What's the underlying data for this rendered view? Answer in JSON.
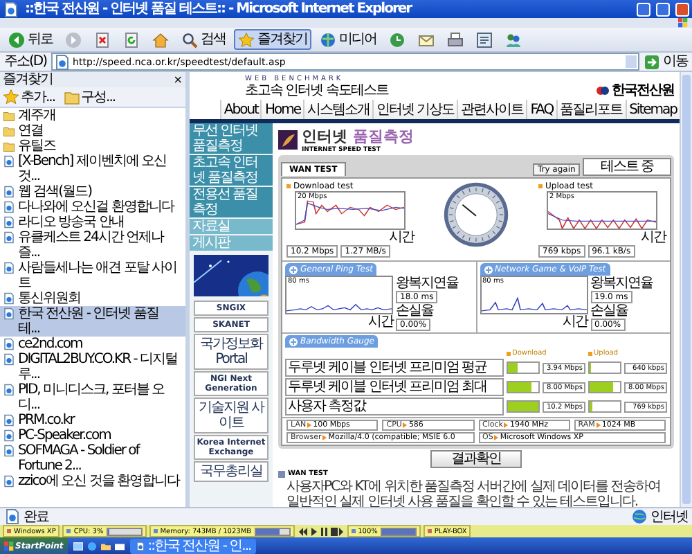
{
  "window": {
    "title": "::한국 전산원 - 인터넷 품질 테스트:: - Microsoft Internet Explorer"
  },
  "toolbar": [
    {
      "kind": "back",
      "label": "뒤로",
      "pressed": false
    },
    {
      "kind": "forward",
      "pressed": false
    },
    {
      "kind": "stop",
      "pressed": false
    },
    {
      "kind": "refresh",
      "pressed": false
    },
    {
      "kind": "home",
      "pressed": false
    },
    {
      "kind": "search",
      "label": "검색",
      "pressed": false
    },
    {
      "kind": "favorites",
      "label": "즐겨찾기",
      "pressed": true
    },
    {
      "kind": "media",
      "label": "미디어",
      "pressed": false
    },
    {
      "kind": "history",
      "pressed": false
    },
    {
      "kind": "mail",
      "pressed": false
    },
    {
      "kind": "print",
      "pressed": false
    },
    {
      "kind": "edit",
      "pressed": false
    },
    {
      "kind": "messenger",
      "pressed": false
    }
  ],
  "address_bar": {
    "label": "주소(D)",
    "url": "http://speed.nca.or.kr/speedtest/default.asp",
    "go": "이동"
  },
  "favorites": {
    "title": "즐겨찾기",
    "close": "×",
    "add": "추가...",
    "organize": "구성...",
    "items": [
      {
        "kind": "folder",
        "label": "계주개",
        "selected": false
      },
      {
        "kind": "folder",
        "label": "연결",
        "selected": false
      },
      {
        "kind": "folder",
        "label": "유틸즈",
        "selected": false
      },
      {
        "kind": "link",
        "label": "[X-Bench] 제이벤치에 오신 것...",
        "selected": false
      },
      {
        "kind": "link",
        "label": "웹 검색(월드)",
        "selected": false
      },
      {
        "kind": "link",
        "label": "다나와에 오신걸 환영합니다",
        "selected": false
      },
      {
        "kind": "link",
        "label": "라디오 방송국 안내",
        "selected": false
      },
      {
        "kind": "link",
        "label": "유클케스트 24시간 언제나 즐...",
        "selected": false
      },
      {
        "kind": "link",
        "label": "사람들세나는 애견 포탈 사이트",
        "selected": false
      },
      {
        "kind": "link",
        "label": "통신위원회",
        "selected": false
      },
      {
        "kind": "link",
        "label": "한국 전산원 - 인터넷 품질 테...",
        "selected": true
      },
      {
        "kind": "link",
        "label": "ce2nd.com",
        "selected": false
      },
      {
        "kind": "link",
        "label": "DIGITAL2BUY.CO.KR - 디지털루...",
        "selected": false
      },
      {
        "kind": "link",
        "label": "PID, 미니디스크, 포터블 오디...",
        "selected": false
      },
      {
        "kind": "link",
        "label": "PRM.co.kr",
        "selected": false
      },
      {
        "kind": "link",
        "label": "PC-Speaker.com",
        "selected": false
      },
      {
        "kind": "link",
        "label": "SOFMAGA - Soldier of Fortune 2...",
        "selected": false
      },
      {
        "kind": "link",
        "label": "zzico에 오신 것을 환영합니다",
        "selected": false
      }
    ]
  },
  "page": {
    "brand": "WEB BENCHMARK",
    "subtitle": "초고속 인터넷 속도테스트",
    "org": "한국전산원",
    "menu": [
      "About",
      "Home",
      "시스템소개",
      "인터넷 기상도",
      "관련사이트",
      "FAQ",
      "품질리포트",
      "Sitemap"
    ],
    "nav": [
      "무선 인터넷 품질측정",
      "초고속 인터넷 품질측정",
      "전용선 품질측정",
      "자료실",
      "게시판"
    ],
    "banners": [
      {
        "kind": "picture"
      },
      {
        "kind": "logo",
        "text": "SNGIX"
      },
      {
        "kind": "logo",
        "text": "SKANET"
      },
      {
        "kind": "logo",
        "text": "국가정보화 Portal"
      },
      {
        "kind": "logo",
        "text": "NGI Next Generation"
      },
      {
        "kind": "logo",
        "text": "기술지원 사이트"
      },
      {
        "kind": "logo",
        "text": "Korea Internet Exchange"
      },
      {
        "kind": "logo",
        "text": "국무총리실"
      }
    ],
    "test": {
      "heading": "인터넷",
      "heading_accent": "품질측정",
      "heading_sub": "INTERNET SPEED TEST",
      "tab": "WAN TEST",
      "retry": "Try again",
      "status": "테스트 중",
      "download": {
        "title": "Download test",
        "scale": "20 Mbps",
        "axis": "시간",
        "rate": "10.2 Mbps",
        "bytes": "1.27 MB/s"
      },
      "upload": {
        "title": "Upload test",
        "scale": "2 Mbps",
        "axis": "시간",
        "rate": "769 kbps",
        "bytes": "96.1 kB/s"
      },
      "ping": [
        {
          "title": "General Ping Test",
          "scale": "80 ms",
          "delay_label": "왕복지연율",
          "delay": "18.0 ms",
          "loss_label": "손실율",
          "loss": "0.00%",
          "axis": "시간"
        },
        {
          "title": "Network Game & VoIP Test",
          "scale": "80 ms",
          "delay_label": "왕복지연율",
          "delay": "19.0 ms",
          "loss_label": "손실율",
          "loss": "0.00%",
          "axis": "시간"
        }
      ],
      "bandwidth": {
        "title": "Bandwidth Gauge",
        "download_label": "Download",
        "upload_label": "Upload",
        "rows": [
          {
            "label": "두루넷 케이블 인터넷 프리미엄 평균",
            "download": {
              "level": 0.3,
              "reading": "3.94 Mbps"
            },
            "upload": {
              "level": 0.06,
              "reading": "640 kbps"
            }
          },
          {
            "label": "두루넷 케이블 인터넷 프리미엄 최대",
            "download": {
              "level": 0.78,
              "reading": "8.00 Mbps"
            },
            "upload": {
              "level": 0.78,
              "reading": "8.00 Mbps"
            }
          },
          {
            "label": "사용자 측정값",
            "download": {
              "level": 0.98,
              "reading": "10.2 Mbps"
            },
            "upload": {
              "level": 0.07,
              "reading": "769 kbps"
            }
          }
        ]
      },
      "system": [
        {
          "label": "LAN",
          "value": "100 Mbps"
        },
        {
          "label": "CPU",
          "value": "586"
        },
        {
          "label": "Clock",
          "value": "1940 MHz"
        },
        {
          "label": "RAM",
          "value": "1024 MB"
        },
        {
          "label": "Browser",
          "value": "Mozilla/4.0 (compatible; MSIE 6.0"
        },
        {
          "label": "OS",
          "value": "Microsoft Windows XP"
        }
      ],
      "result_button": "결과확인",
      "note": {
        "title": "WAN TEST",
        "text": "사용자PC와 KT에 위치한 품질측정 서버간에 실제 데이터를 전송하여 일반적인 실제 인터넷 사용 품질을 확인할 수 있는 테스트입니다."
      }
    }
  },
  "status_bar": {
    "text": "완료",
    "zone": "인터넷"
  },
  "deskbar": [
    {
      "kind": "label",
      "text": "Windows XP"
    },
    {
      "kind": "meter",
      "text": "CPU: 3%",
      "level": 0.04
    },
    {
      "kind": "meter",
      "text": "Memory: 743MB / 1023MB",
      "level": 0.73
    },
    {
      "kind": "media"
    },
    {
      "kind": "meter",
      "text": "100%",
      "level": 1
    },
    {
      "kind": "label",
      "text": "PLAY-BOX"
    }
  ],
  "taskbar": {
    "start": "StartPoint",
    "task": "::한국 전산원 - 인..."
  }
}
